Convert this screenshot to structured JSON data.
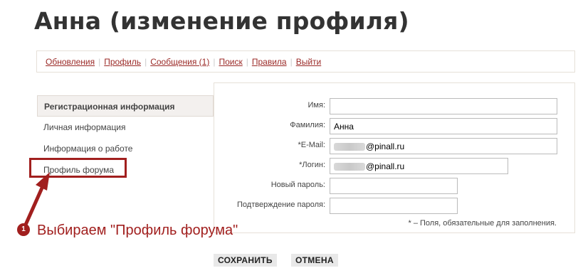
{
  "page": {
    "title": "Анна (изменение профиля)"
  },
  "nav": {
    "items": [
      "Обновления",
      "Профиль",
      "Сообщения (1)",
      "Поиск",
      "Правила",
      "Выйти"
    ]
  },
  "sidebar": {
    "items": [
      {
        "label": "Регистрационная информация",
        "active": true
      },
      {
        "label": "Личная информация",
        "active": false
      },
      {
        "label": "Информация о работе",
        "active": false
      },
      {
        "label": "Профиль форума",
        "active": false
      }
    ]
  },
  "form": {
    "fields": [
      {
        "label": "Имя:",
        "value": ""
      },
      {
        "label": "Фамилия:",
        "value": "Анна"
      },
      {
        "label": "*E-Mail:",
        "value": "@pinall.ru",
        "obscured": true
      },
      {
        "label": "*Логин:",
        "value": "@pinall.ru",
        "obscured": true
      },
      {
        "label": "Новый пароль:",
        "value": ""
      },
      {
        "label": "Подтверждение пароля:",
        "value": ""
      }
    ],
    "note": "* – Поля, обязательные для заполнения."
  },
  "buttons": {
    "save": "СОХРАНИТЬ",
    "cancel": "ОТМЕНА"
  },
  "annotation": {
    "number": "1",
    "text": "Выбираем \"Профиль форума\"",
    "color": "#a11f1e"
  },
  "colors": {
    "link": "#9b2a27",
    "accent": "#a11f1e"
  }
}
